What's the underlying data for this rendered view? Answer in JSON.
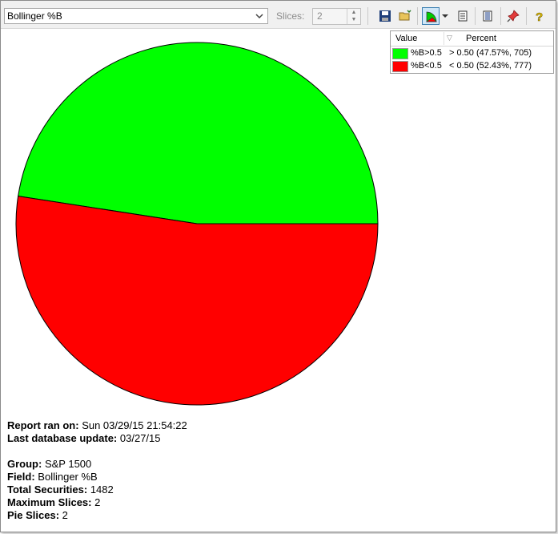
{
  "toolbar": {
    "field_select": "Bollinger %B",
    "slices_label": "Slices:",
    "slices_value": "2",
    "buttons": [
      "save-icon",
      "open-folder-icon",
      "pie-chart-icon",
      "dropdown-arrow-icon",
      "report-icon",
      "list-icon",
      "pin-icon",
      "help-icon"
    ]
  },
  "legend": {
    "col_value": "Value",
    "col_percent": "Percent",
    "rows": [
      {
        "color": "#00ff00",
        "name": "%B>0.5",
        "percent": "> 0.50 (47.57%, 705)"
      },
      {
        "color": "#ff0000",
        "name": "%B<0.5",
        "percent": "< 0.50 (52.43%, 777)"
      }
    ]
  },
  "chart_data": {
    "type": "pie",
    "labels": [
      "%B>0.5",
      "%B<0.5"
    ],
    "values": [
      47.57,
      52.43
    ],
    "counts": [
      705,
      777
    ],
    "colors": [
      "#00ff00",
      "#ff0000"
    ]
  },
  "info": {
    "report_ran_label": "Report ran on:",
    "report_ran_value": "Sun 03/29/15 21:54:22",
    "db_update_label": "Last database update:",
    "db_update_value": "03/27/15",
    "group_label": "Group:",
    "group_value": "S&P 1500",
    "field_label": "Field:",
    "field_value": "Bollinger %B",
    "total_label": "Total Securities:",
    "total_value": "1482",
    "max_slices_label": "Maximum Slices:",
    "max_slices_value": "2",
    "pie_slices_label": "Pie Slices:",
    "pie_slices_value": "2"
  }
}
